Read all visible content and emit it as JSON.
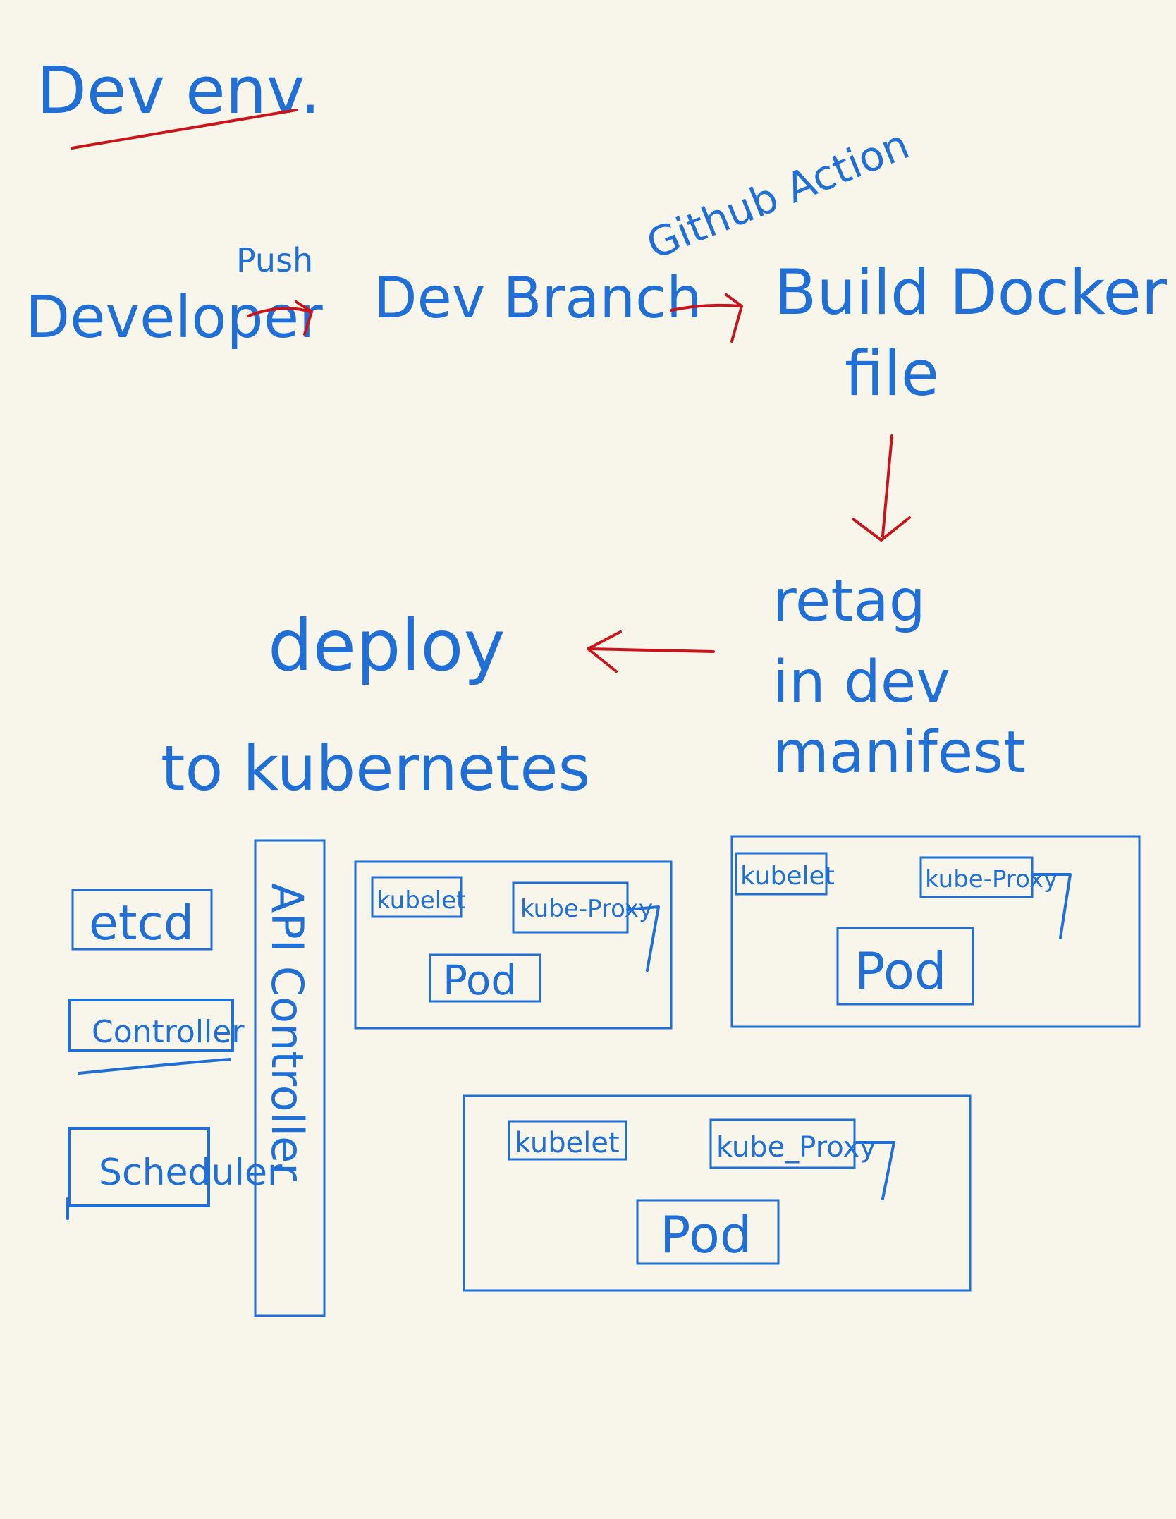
{
  "title": "Dev env.",
  "flow": {
    "developer": "Developer",
    "push_label": "Push",
    "dev_branch": "Dev Branch",
    "github_action_label": "Github Action",
    "build_line1": "Build Docker",
    "build_line2": "file",
    "retag_line1": "retag",
    "retag_line2": "in dev",
    "retag_line3": "manifest",
    "deploy_line1": "deploy",
    "deploy_line2": "to kubernetes"
  },
  "cluster": {
    "etcd": "etcd",
    "controller": "Controller",
    "scheduler": "Scheduler",
    "api_controller": "API Controller",
    "nodes": [
      {
        "kubelet": "kubelet",
        "kube_proxy": "kube-Proxy",
        "pod": "Pod"
      },
      {
        "kubelet": "kubelet",
        "kube_proxy": "kube-Proxy",
        "pod": "Pod"
      },
      {
        "kubelet": "kubelet",
        "kube_proxy": "kube_Proxy",
        "pod": "Pod"
      }
    ]
  },
  "colors": {
    "ink_blue": "#1f6fd6",
    "ink_red": "#c8141a",
    "paper": "#f8f5ea"
  }
}
